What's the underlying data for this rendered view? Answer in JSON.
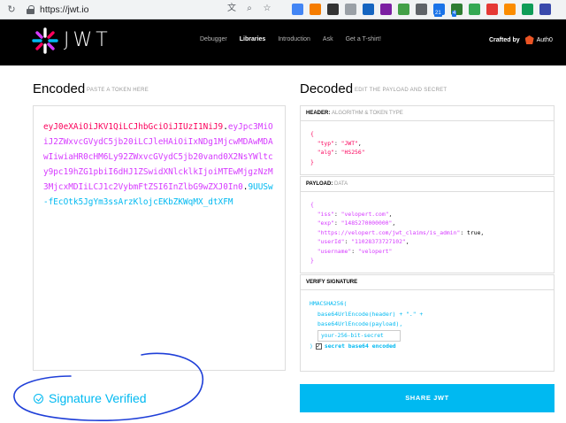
{
  "browser": {
    "url": "https://jwt.io",
    "extension_colors": [
      "#4285f4",
      "#f57c00",
      "#333333",
      "#9aa0a6",
      "#1565c0",
      "#7b1fa2",
      "#43a047",
      "#5f6368",
      "#1a73e8",
      "#2e7d32",
      "#34a853",
      "#e53935",
      "#fb8c00",
      "#0f9d58",
      "#3949ab"
    ],
    "badges": [
      "21",
      "4"
    ]
  },
  "header": {
    "logo_text": "JWT",
    "nav": [
      "Debugger",
      "Libraries",
      "Introduction",
      "Ask",
      "Get a T-shirt!"
    ],
    "active_nav": "Libraries",
    "crafted_by": "Crafted by",
    "brand": "Auth0"
  },
  "encoded": {
    "title": "Encoded",
    "subtitle": "PASTE A TOKEN HERE",
    "header_part": "eyJ0eXAiOiJKV1QiLCJhbGciOiJIUzI1NiJ9",
    "payload_part": "eyJpc3MiOiJ2ZWxvcGVydC5jb20iLCJleHAiOiIxNDg1MjcwMDAwMDAwIiwiaHR0cHM6Ly92ZWxvcGVydC5jb20vand0X2NsYWltcy9pc19hZG1pbiI6dHJ1ZSwidXNlcklkIjoiMTEwMjgzNzM3MjcxMDIiLCJ1c2VybmFtZSI6InZlbG9wZXJ0In0",
    "signature_part": "9UUSw-fEcOtk5JgYm3ssArzKlojcEKbZKWqMX_dtXFM",
    "dot": "."
  },
  "decoded": {
    "title": "Decoded",
    "subtitle": "EDIT THE PAYLOAD AND SECRET",
    "header_panel": {
      "label": "HEADER:",
      "note": "ALGORITHM & TOKEN TYPE",
      "typ": "JWT",
      "alg": "HS256"
    },
    "payload_panel": {
      "label": "PAYLOAD:",
      "note": "DATA",
      "iss": "velopert.com",
      "exp": "1485270000000",
      "claim_key": "https://velopert.com/jwt_claims/is_admin",
      "claim_value": "true",
      "userId": "11028373727102",
      "username": "velopert"
    },
    "verify_panel": {
      "label": "VERIFY SIGNATURE",
      "fn": "HMACSHA256(",
      "line1": "base64UrlEncode(header) + \".\" +",
      "line2": "base64UrlEncode(payload),",
      "secret_placeholder": "your-256-bit-secret",
      "close": ")",
      "checkbox_label": "secret base64 encoded"
    }
  },
  "footer": {
    "verified_text": "Signature Verified",
    "share_button": "SHARE JWT"
  }
}
